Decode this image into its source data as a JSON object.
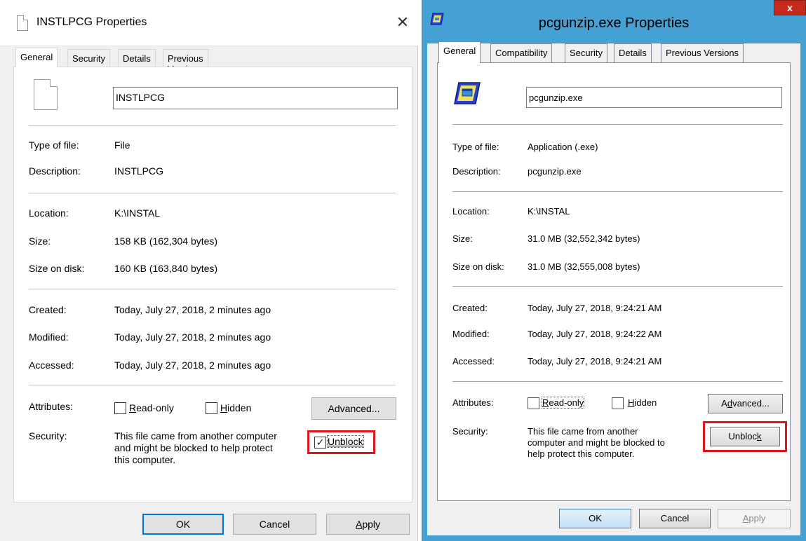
{
  "left": {
    "title": "INSTLPCG Properties",
    "tabs": [
      "General",
      "Security",
      "Details",
      "Previous Versions"
    ],
    "file_name": "INSTLPCG",
    "type_label": "Type of file:",
    "type_value": "File",
    "description_label": "Description:",
    "description_value": "INSTLPCG",
    "location_label": "Location:",
    "location_value": "K:\\INSTAL",
    "size_label": "Size:",
    "size_value": "158 KB (162,304 bytes)",
    "size_on_disk_label": "Size on disk:",
    "size_on_disk_value": "160 KB (163,840 bytes)",
    "created_label": "Created:",
    "created_value": "Today, July 27, 2018, 2 minutes ago",
    "modified_label": "Modified:",
    "modified_value": "Today, July 27, 2018, 2 minutes ago",
    "accessed_label": "Accessed:",
    "accessed_value": "Today, July 27, 2018, 2 minutes ago",
    "attributes_label": "Attributes:",
    "readonly_label": "Read-only",
    "hidden_label": "Hidden",
    "advanced_label": "Advanced...",
    "security_label": "Security:",
    "security_line1": "This file came from another computer",
    "security_line2": "and might be blocked to help protect",
    "security_line3": "this computer.",
    "unblock_label": "Unblock",
    "unblock_checked": true,
    "ok_label": "OK",
    "cancel_label": "Cancel",
    "apply_label": "Apply"
  },
  "right": {
    "title": "pcgunzip.exe Properties",
    "close_label": "x",
    "tabs": [
      "General",
      "Compatibility",
      "Security",
      "Details",
      "Previous Versions"
    ],
    "file_name": "pcgunzip.exe",
    "type_label": "Type of file:",
    "type_value": "Application (.exe)",
    "description_label": "Description:",
    "description_value": "pcgunzip.exe",
    "location_label": "Location:",
    "location_value": "K:\\INSTAL",
    "size_label": "Size:",
    "size_value": "31.0 MB (32,552,342 bytes)",
    "size_on_disk_label": "Size on disk:",
    "size_on_disk_value": "31.0 MB (32,555,008 bytes)",
    "created_label": "Created:",
    "created_value": "Today, July 27, 2018, 9:24:21 AM",
    "modified_label": "Modified:",
    "modified_value": "Today, July 27, 2018, 9:24:22 AM",
    "accessed_label": "Accessed:",
    "accessed_value": "Today, July 27, 2018, 9:24:21 AM",
    "attributes_label": "Attributes:",
    "readonly_label": "Read-only",
    "hidden_label": "Hidden",
    "advanced_label": "Advanced...",
    "security_label": "Security:",
    "security_line1": "This file came from another",
    "security_line2": "computer and might be blocked to",
    "security_line3": "help protect this computer.",
    "unblock_label": "Unblock",
    "ok_label": "OK",
    "cancel_label": "Cancel",
    "apply_label": "Apply"
  },
  "colors": {
    "highlight_red": "#e0161c",
    "win7_frame_blue": "#45a0d4",
    "win10_focus_blue": "#0078d7",
    "close_red": "#c42b1c"
  }
}
